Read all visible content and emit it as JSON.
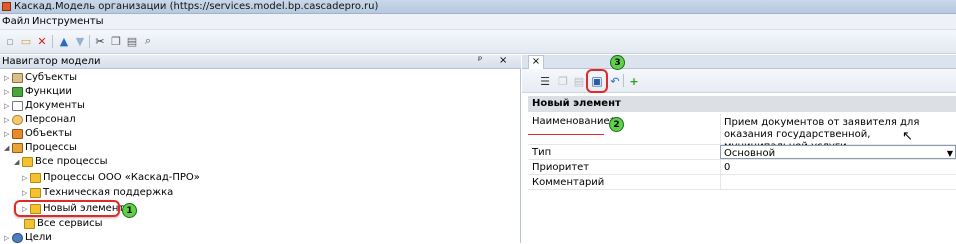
{
  "window": {
    "title": "Каскад.Модель организации (https://services.model.bp.cascadepro.ru)"
  },
  "menu": [
    "Файл",
    "Инструменты"
  ],
  "navigator": {
    "title": "Навигатор модели",
    "pin_glyph": "ᵖ",
    "close_glyph": "×",
    "items": [
      {
        "label": "Субъекты",
        "level": 0,
        "expanded": false
      },
      {
        "label": "Функции",
        "level": 0,
        "expanded": false
      },
      {
        "label": "Документы",
        "level": 0,
        "expanded": false
      },
      {
        "label": "Персонал",
        "level": 0,
        "expanded": false
      },
      {
        "label": "Объекты",
        "level": 0,
        "expanded": false
      },
      {
        "label": "Процессы",
        "level": 0,
        "expanded": true
      },
      {
        "label": "Все процессы",
        "level": 1,
        "expanded": true
      },
      {
        "label": "Процессы ООО «Каскад-ПРО»",
        "level": 2,
        "expanded": false
      },
      {
        "label": "Техническая поддержка",
        "level": 2,
        "expanded": false
      },
      {
        "label": "Новый элемент",
        "level": 2,
        "expanded": false
      },
      {
        "label": "Все сервисы",
        "level": 1,
        "expanded": false
      },
      {
        "label": "Цели",
        "level": 0,
        "expanded": false
      }
    ]
  },
  "editor": {
    "tab_close": "×",
    "section_title": "Новый элемент",
    "properties": [
      {
        "label": "Наименование*",
        "value": "Прием документов от заявителя для оказания государственной, муниципальной услуги"
      },
      {
        "label": "Тип",
        "value": "Основной"
      },
      {
        "label": "Приоритет",
        "value": "0"
      },
      {
        "label": "Комментарий",
        "value": ""
      }
    ]
  },
  "badges": [
    "1",
    "2",
    "3"
  ],
  "colors": {
    "highlight": "#e02a2a",
    "badge": "#5fd04a"
  }
}
